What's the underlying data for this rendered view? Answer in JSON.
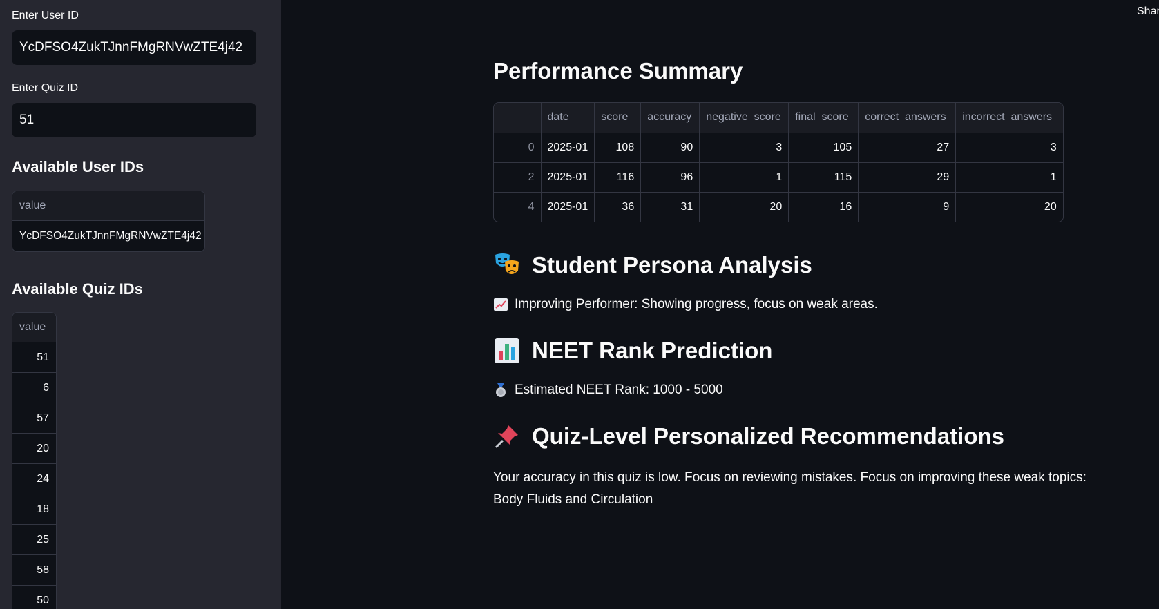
{
  "sidebar": {
    "user_id_label": "Enter User ID",
    "user_id_value": "YcDFSO4ZukTJnnFMgRNVwZTE4j42",
    "quiz_id_label": "Enter Quiz ID",
    "quiz_id_value": "51",
    "available_users_heading": "Available User IDs",
    "available_users_column": "value",
    "available_users": [
      "YcDFSO4ZukTJnnFMgRNVwZTE4j42"
    ],
    "available_quizzes_heading": "Available Quiz IDs",
    "available_quizzes_column": "value",
    "available_quizzes": [
      "51",
      "6",
      "57",
      "20",
      "24",
      "18",
      "25",
      "58",
      "50"
    ]
  },
  "header": {
    "share_label": "Share"
  },
  "performance": {
    "title": "Performance Summary",
    "columns": [
      "",
      "date",
      "score",
      "accuracy",
      "negative_score",
      "final_score",
      "correct_answers",
      "incorrect_answers"
    ],
    "rows": [
      [
        "0",
        "2025-01",
        "108",
        "90",
        "3",
        "105",
        "27",
        "3"
      ],
      [
        "2",
        "2025-01",
        "116",
        "96",
        "1",
        "115",
        "29",
        "1"
      ],
      [
        "4",
        "2025-01",
        "36",
        "31",
        "20",
        "16",
        "9",
        "20"
      ]
    ]
  },
  "persona": {
    "title": "Student Persona Analysis",
    "icon": "performing-arts-icon",
    "text": "Improving Performer: Showing progress, focus on weak areas.",
    "text_icon": "chart-increasing-icon"
  },
  "rank": {
    "title": "NEET Rank Prediction",
    "icon": "bar-chart-icon",
    "text": "Estimated NEET Rank: 1000 - 5000",
    "text_icon": "medal-icon"
  },
  "recommendations": {
    "title": "Quiz-Level Personalized Recommendations",
    "icon": "pushpin-icon",
    "text": "Your accuracy in this quiz is low. Focus on reviewing mistakes. Focus on improving these weak topics: Body Fluids and Circulation"
  },
  "colors": {
    "background": "#0e1117",
    "sidebar": "#262730",
    "border": "#333642",
    "muted_text": "#a3a8b8"
  }
}
